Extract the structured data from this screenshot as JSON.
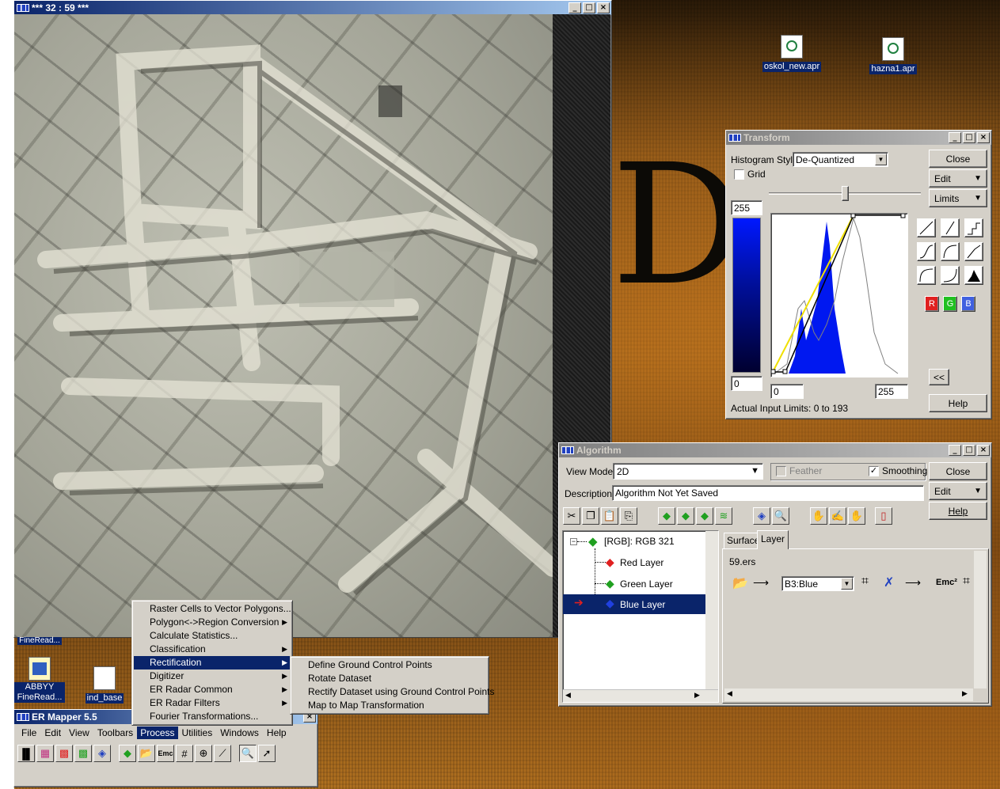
{
  "viewer": {
    "title": "*** 32 : 59 ***"
  },
  "desktop": {
    "icons": [
      {
        "label": "oskol_new.apr"
      },
      {
        "label": "hazna1.apr"
      },
      {
        "label": "ABBYY FineRead..."
      },
      {
        "label": "ind_base"
      },
      {
        "label": "FineRead..."
      }
    ]
  },
  "transform": {
    "title": "Transform",
    "histogram_style_label": "Histogram Style:",
    "histogram_style_value": "De-Quantized",
    "grid_label": "Grid",
    "grid_checked": false,
    "close_label": "Close",
    "edit_label": "Edit",
    "limits_label": "Limits",
    "max_output": "255",
    "min_output": "0",
    "min_input": "0",
    "max_input": "255",
    "collapse_label": "<<",
    "help_label": "Help",
    "actual_limits": "Actual Input Limits: 0 to 193",
    "rgb": [
      "R",
      "G",
      "B"
    ],
    "rgb_colors": [
      "#e02020",
      "#20c020",
      "#4060e0"
    ]
  },
  "algorithm": {
    "title": "Algorithm",
    "view_mode_label": "View Mode:",
    "view_mode_value": "2D",
    "feather_label": "Feather",
    "smoothing_label": "Smoothing",
    "smoothing_checked": true,
    "close_label": "Close",
    "description_label": "Description:",
    "description_value": "Algorithm Not Yet Saved",
    "edit_label": "Edit",
    "help_label": "Help",
    "tree_root": "[RGB]: RGB 321",
    "layers": [
      {
        "label": "Red Layer",
        "letter": "R",
        "color": "#e02020"
      },
      {
        "label": "Green Layer",
        "letter": "G",
        "color": "#20a020"
      },
      {
        "label": "Blue Layer",
        "letter": "B",
        "color": "#2040e0"
      }
    ],
    "tabs": [
      "Surface",
      "Layer"
    ],
    "dataset": "59.ers",
    "band_value": "B3:Blue",
    "formula_label": "Emc²"
  },
  "process_menu": {
    "items": [
      {
        "label": "Raster Cells to Vector Polygons...",
        "submenu": false
      },
      {
        "label": "Polygon<->Region Conversion",
        "submenu": true
      },
      {
        "label": "Calculate Statistics...",
        "submenu": false
      },
      {
        "label": "Classification",
        "submenu": true
      },
      {
        "label": "Rectification",
        "submenu": true
      },
      {
        "label": "Digitizer",
        "submenu": true
      },
      {
        "label": "ER Radar Common",
        "submenu": true
      },
      {
        "label": "ER Radar Filters",
        "submenu": true
      },
      {
        "label": "Fourier Transformations...",
        "submenu": false
      }
    ]
  },
  "rectification_menu": {
    "items": [
      "Define Ground Control Points",
      "Rotate Dataset",
      "Rectify Dataset using Ground Control Points",
      "Map to Map Transformation"
    ]
  },
  "main_window": {
    "title": "ER Mapper 5.5",
    "menus": [
      "File",
      "Edit",
      "View",
      "Toolbars",
      "Process",
      "Utilities",
      "Windows",
      "Help"
    ]
  }
}
